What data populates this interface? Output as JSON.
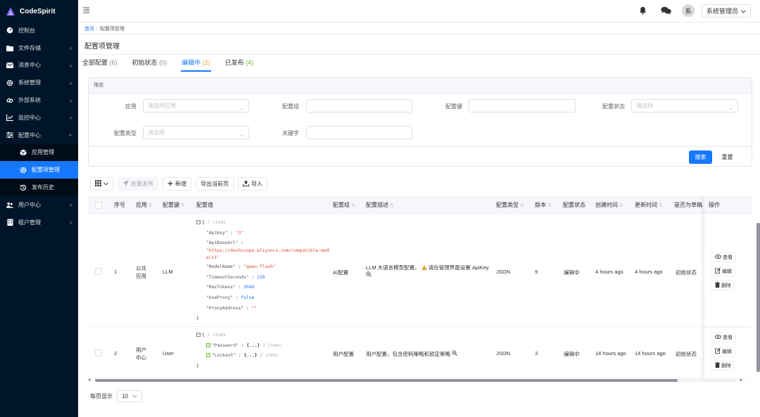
{
  "app": {
    "name": "CodeSpirit"
  },
  "colors": {
    "sidebar_bg": "#001529",
    "primary": "#1677ff",
    "warning": "#e6a23c",
    "success": "#67c23a"
  },
  "sidebar": {
    "items": [
      {
        "label": "控制台",
        "icon": "dashboard-icon"
      },
      {
        "label": "文件存储",
        "icon": "folder-icon"
      },
      {
        "label": "消息中心",
        "icon": "mail-icon"
      },
      {
        "label": "系统管理",
        "icon": "gear-icon"
      },
      {
        "label": "外部系统",
        "icon": "link-icon"
      },
      {
        "label": "监控中心",
        "icon": "chart-line-icon"
      },
      {
        "label": "配置中心",
        "icon": "sliders-icon"
      },
      {
        "label": "用户中心",
        "icon": "users-icon"
      },
      {
        "label": "租户管理",
        "icon": "building-icon"
      }
    ],
    "config_submenu": [
      {
        "label": "应用管理",
        "icon": "cube-icon"
      },
      {
        "label": "配置项管理",
        "icon": "gear-icon"
      },
      {
        "label": "发布历史",
        "icon": "history-icon"
      }
    ]
  },
  "header": {
    "avatar_text": "系",
    "user_label": "系统管理员"
  },
  "breadcrumb": {
    "home": "首页",
    "sep": "/",
    "current": "配置项管理"
  },
  "page": {
    "title": "配置项管理"
  },
  "tabs": [
    {
      "label": "全部配置",
      "count": "(6)"
    },
    {
      "label": "初始状态",
      "count": "(0)"
    },
    {
      "label": "编辑中",
      "count": "(2)"
    },
    {
      "label": "已发布",
      "count": "(4)"
    }
  ],
  "filter": {
    "title": "筛选",
    "app_label": "应用",
    "app_placeholder": "请选择应用",
    "group_label": "配置组",
    "key_label": "配置键",
    "status_label": "配置状态",
    "status_placeholder": "请选择",
    "type_label": "配置类型",
    "type_placeholder": "请选择",
    "keyword_label": "关键字",
    "search_btn": "搜索",
    "reset_btn": "重置"
  },
  "toolbar": {
    "batch_publish": "批量发布",
    "add": "新增",
    "export": "导出当前页",
    "import": "导入"
  },
  "table": {
    "headers": [
      "序号",
      "应用",
      "配置键",
      "配置值",
      "配置组",
      "配置描述",
      "配置类型",
      "版本",
      "配置状态",
      "创建时间",
      "更新时间",
      "是否为草稿",
      "操作"
    ],
    "rows": [
      {
        "index": "1",
        "app": "公共应用",
        "key": "LLM",
        "json": {
          "open": "{",
          "meta": "7 items",
          "entries": [
            {
              "k": "\"ApiKey\"",
              "v": "\"3\"",
              "t": "s"
            },
            {
              "k": "\"ApiBaseUrl\"",
              "v": "\"https://dashscope.aliyuncs.com/compatible-mode/v1\"",
              "t": "s"
            },
            {
              "k": "\"ModelName\"",
              "v": "\"qwen-flash\"",
              "t": "s"
            },
            {
              "k": "\"TimeoutSeconds\"",
              "v": "120",
              "t": "n"
            },
            {
              "k": "\"MaxTokens\"",
              "v": "2048",
              "t": "n"
            },
            {
              "k": "\"UseProxy\"",
              "v": "false",
              "t": "b"
            },
            {
              "k": "\"ProxyAddress\"",
              "v": "\"\"",
              "t": "s"
            }
          ],
          "close": "}"
        },
        "group": "AI配置",
        "desc": "LLM 大语言模型配置。",
        "desc_warn": "请在管理界面设置 ApiKey",
        "type": "JSON",
        "version": "9",
        "status": "编辑中",
        "created": "4 hours ago",
        "updated": "4 hours ago",
        "draft": "初始状态"
      },
      {
        "index": "2",
        "app": "用户中心",
        "key": "User",
        "json": {
          "open": "{",
          "meta": "2 items",
          "entries": [
            {
              "k": "\"Password\"",
              "v": "{...}",
              "meta": "3 items"
            },
            {
              "k": "\"Lockout\"",
              "v": "{...}",
              "meta": "2 items"
            }
          ],
          "close": "}"
        },
        "group": "用户配置",
        "desc": "用户配置，包含密码策略和锁定策略",
        "type": "JSON",
        "version": "3",
        "status": "编辑中",
        "created": "14 hours ago",
        "updated": "14 hours ago",
        "draft": "初始状态"
      }
    ],
    "ops": {
      "view": "查看",
      "edit": "编辑",
      "delete": "删除"
    }
  },
  "pager": {
    "label": "每页显示",
    "size": "10"
  }
}
